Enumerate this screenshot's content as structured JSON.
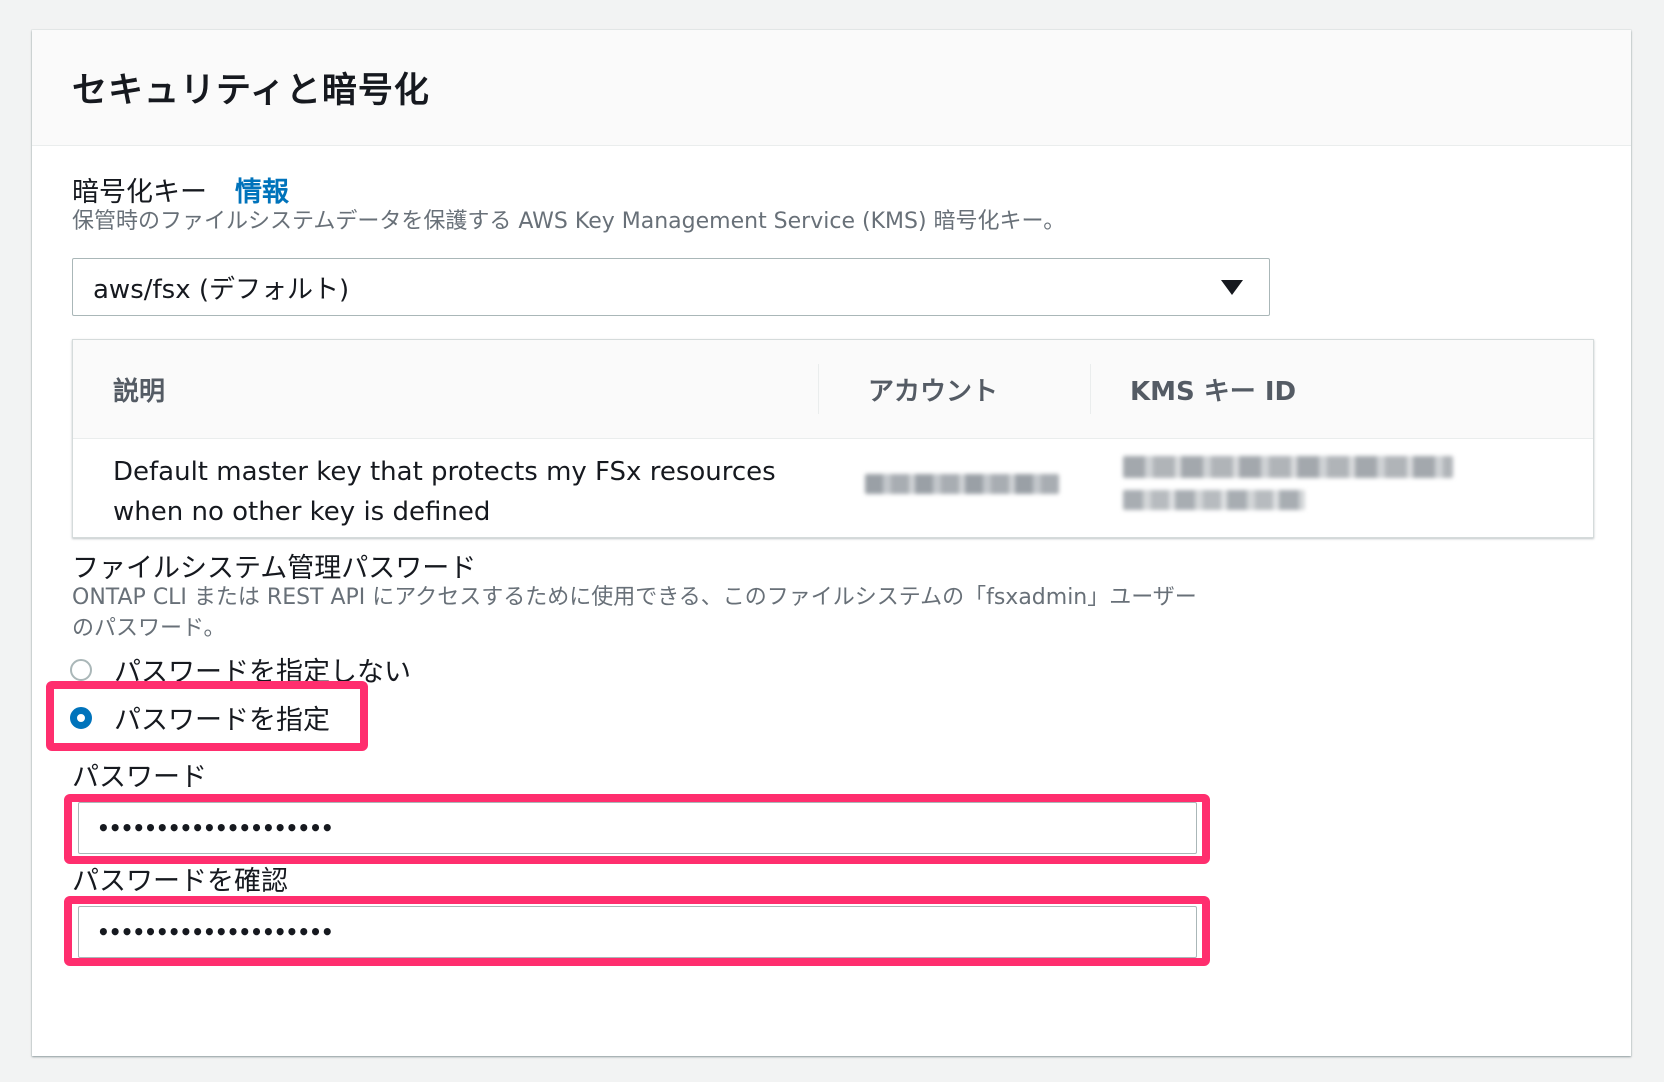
{
  "section": {
    "title": "セキュリティと暗号化"
  },
  "encryption": {
    "label": "暗号化キー",
    "info_link": "情報",
    "description": "保管時のファイルシステムデータを保護する AWS Key Management Service (KMS) 暗号化キー。",
    "selected_value": "aws/fsx (デフォルト)"
  },
  "key_table": {
    "headers": [
      "説明",
      "アカウント",
      "KMS キー ID"
    ],
    "row": {
      "description_line1": "Default master key that protects my FSx resources",
      "description_line2": "when no other key is defined"
    }
  },
  "admin_password": {
    "label": "ファイルシステム管理パスワード",
    "description_line1": "ONTAP CLI または REST API にアクセスするために使用できる、このファイルシステムの「fsxadmin」ユーザー",
    "description_line2": "のパスワード。",
    "options": [
      {
        "label": "パスワードを指定しない",
        "selected": false
      },
      {
        "label": "パスワードを指定",
        "selected": true
      }
    ],
    "password_label": "パスワード",
    "password_value": "••••••••••••••••••••",
    "confirm_label": "パスワードを確認",
    "confirm_value": "••••••••••••••••••••"
  },
  "colors": {
    "accent": "#0073bb",
    "highlight": "#ff2e6e"
  }
}
